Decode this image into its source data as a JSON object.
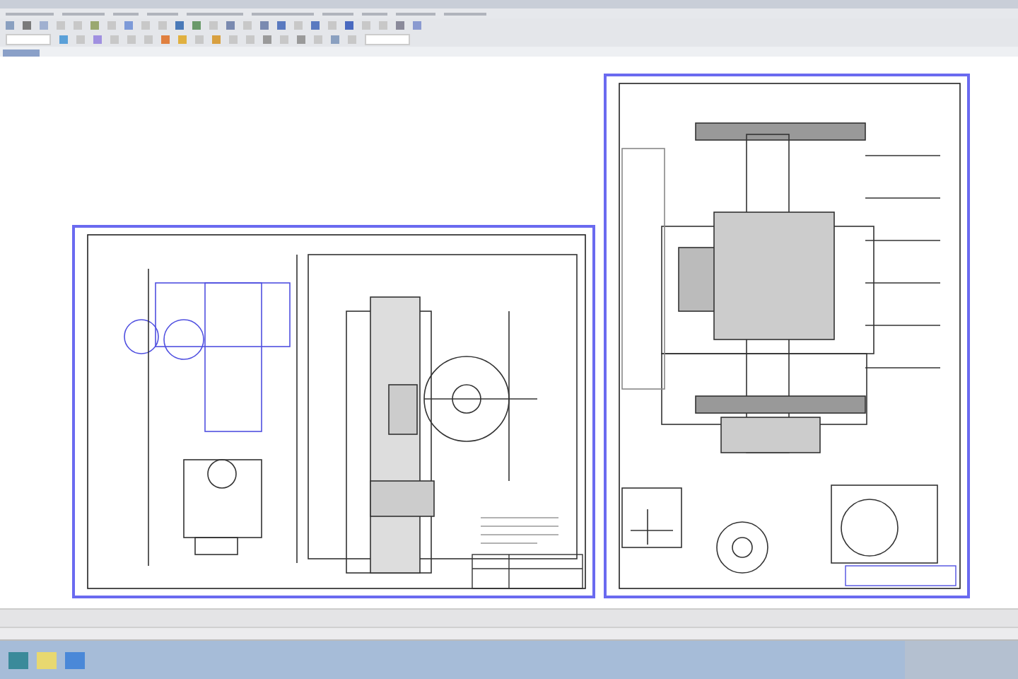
{
  "document_tabs": [
    {
      "selected": true
    }
  ]
}
